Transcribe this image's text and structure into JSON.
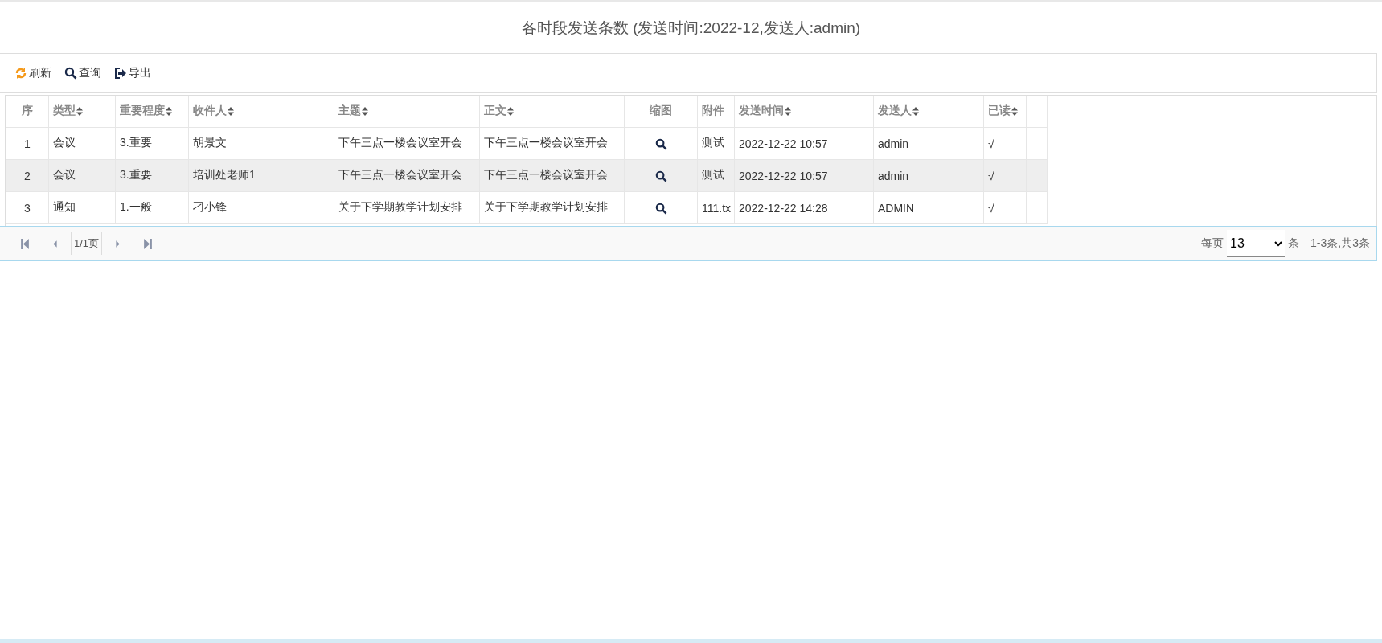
{
  "title": "各时段发送条数 (发送时间:2022-12,发送人:admin)",
  "toolbar": [
    {
      "kind": "refresh",
      "label": "刷新"
    },
    {
      "kind": "search",
      "label": "查询"
    },
    {
      "kind": "export",
      "label": "导出"
    }
  ],
  "table": {
    "columns": [
      {
        "label": "序",
        "sortable": false
      },
      {
        "label": "类型",
        "sortable": true
      },
      {
        "label": "重要程度",
        "sortable": true
      },
      {
        "label": "收件人",
        "sortable": true
      },
      {
        "label": "主题",
        "sortable": true
      },
      {
        "label": "正文",
        "sortable": true
      },
      {
        "label": "缩图",
        "sortable": false
      },
      {
        "label": "附件",
        "sortable": false
      },
      {
        "label": "发送时间",
        "sortable": true
      },
      {
        "label": "发送人",
        "sortable": true
      },
      {
        "label": "已读",
        "sortable": true
      }
    ],
    "rows": [
      {
        "selected": false,
        "cells": [
          "1",
          "会议",
          "3.重要",
          "胡景文",
          "下午三点一楼会议室开会",
          "下午三点一楼会议室开会",
          null,
          "测试",
          "2022-12-22 10:57",
          "admin",
          "√"
        ]
      },
      {
        "selected": true,
        "cells": [
          "2",
          "会议",
          "3.重要",
          "培训处老师1",
          "下午三点一楼会议室开会",
          "下午三点一楼会议室开会",
          null,
          "测试",
          "2022-12-22 10:57",
          "admin",
          "√"
        ]
      },
      {
        "selected": false,
        "cells": [
          "3",
          "通知",
          "1.一般",
          "刁小锋",
          "关于下学期教学计划安排",
          "关于下学期教学计划安排",
          null,
          "111.tx",
          "2022-12-22 14:28",
          "ADMIN",
          "√"
        ]
      }
    ]
  },
  "pager": {
    "page": "1/1页",
    "per_page_label": "每页",
    "per_page": "13",
    "per_page_unit": "条",
    "summary": "1-3条,共3条"
  }
}
